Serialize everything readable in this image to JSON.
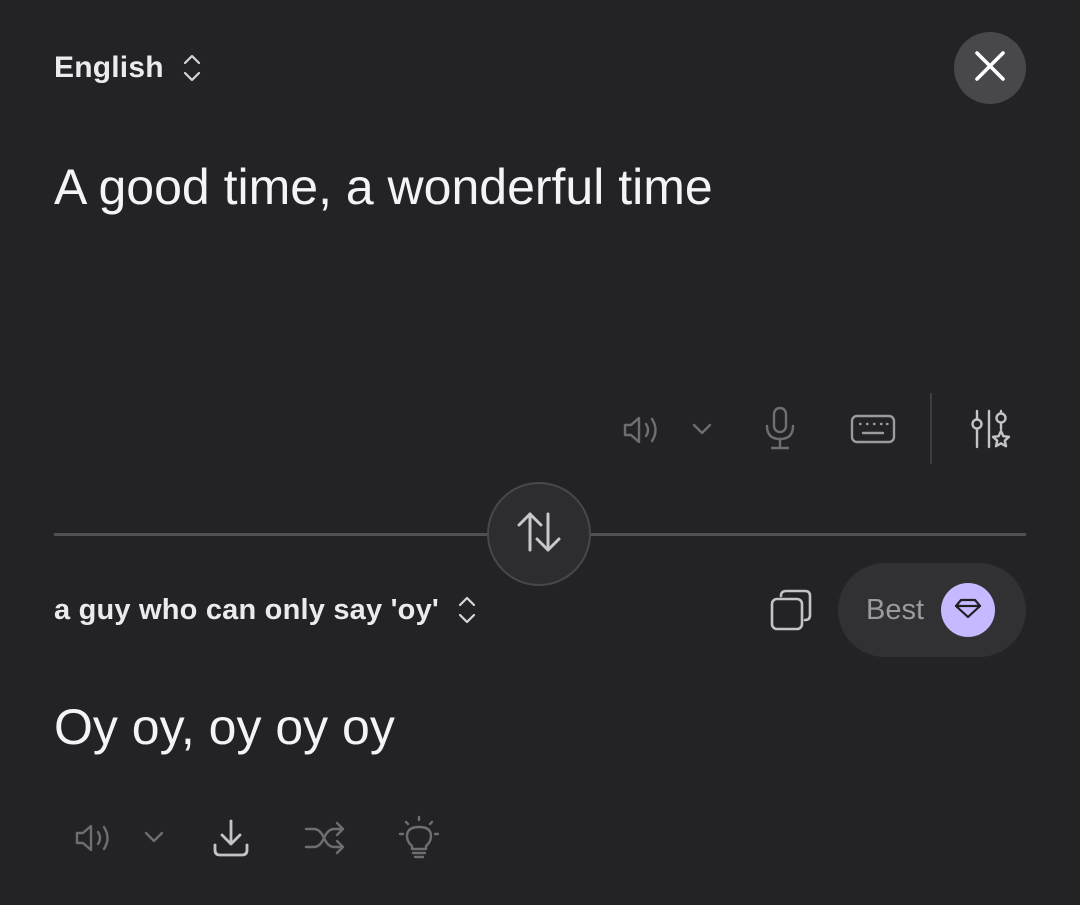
{
  "source": {
    "language": "English",
    "text": "A good time, a wonderful time"
  },
  "target": {
    "language": "a guy who can only say 'oy'",
    "text": "Oy oy, oy oy oy"
  },
  "quality_button": {
    "label": "Best"
  },
  "icons": {
    "close": "close-icon",
    "swap": "swap-arrows-icon",
    "speaker": "speaker-icon",
    "chevron": "chevron-down-icon",
    "microphone": "microphone-icon",
    "keyboard": "keyboard-icon",
    "settings": "sliders-star-icon",
    "copy": "copy-icon",
    "gem": "gem-icon",
    "download": "download-icon",
    "shuffle": "shuffle-icon",
    "idea": "lightbulb-icon"
  },
  "colors": {
    "background": "#232325",
    "accent": "#c7b9ff"
  }
}
